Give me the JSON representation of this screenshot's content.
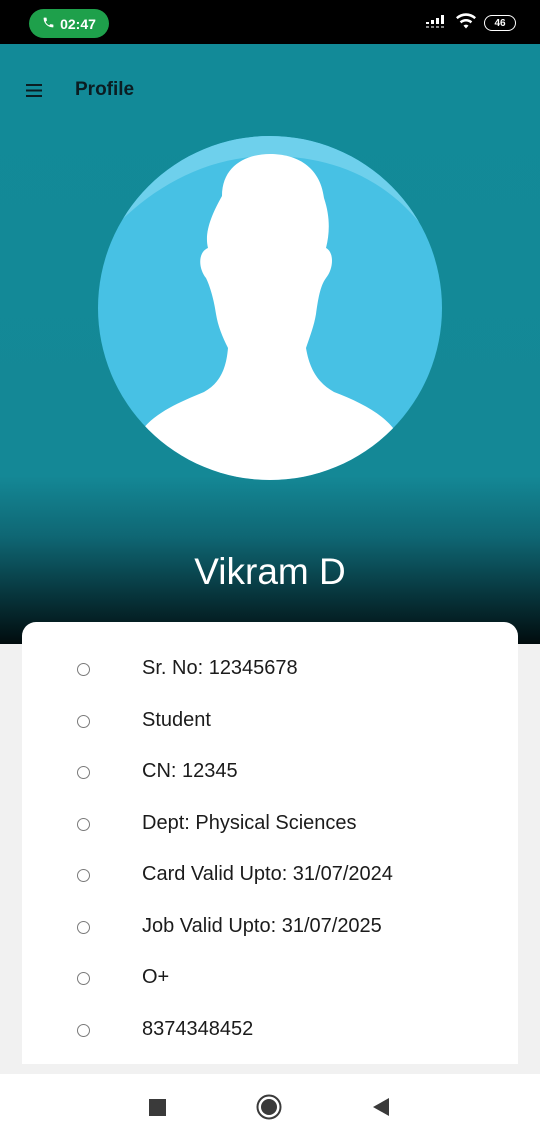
{
  "status_bar": {
    "time": "02:47",
    "battery": "46",
    "icons": [
      "phone-icon",
      "signal-icon",
      "wifi-icon",
      "battery-icon"
    ]
  },
  "toolbar": {
    "title": "Profile",
    "menu_icon": "hamburger-menu-icon"
  },
  "profile": {
    "name": "Vikram D",
    "avatar_icon": "user-silhouette-icon"
  },
  "details": [
    "Sr. No: 12345678",
    "Student",
    "CN: 12345",
    "Dept: Physical Sciences",
    "Card Valid Upto: 31/07/2024",
    "Job Valid Upto: 31/07/2025",
    "O+",
    "8374348452"
  ],
  "nav_bar": {
    "icons": [
      "recent-apps-icon",
      "home-icon",
      "back-icon"
    ]
  },
  "colors": {
    "header_teal": "#128a98",
    "avatar_circle": "#47c1e4",
    "call_pill": "#1ea04b"
  }
}
